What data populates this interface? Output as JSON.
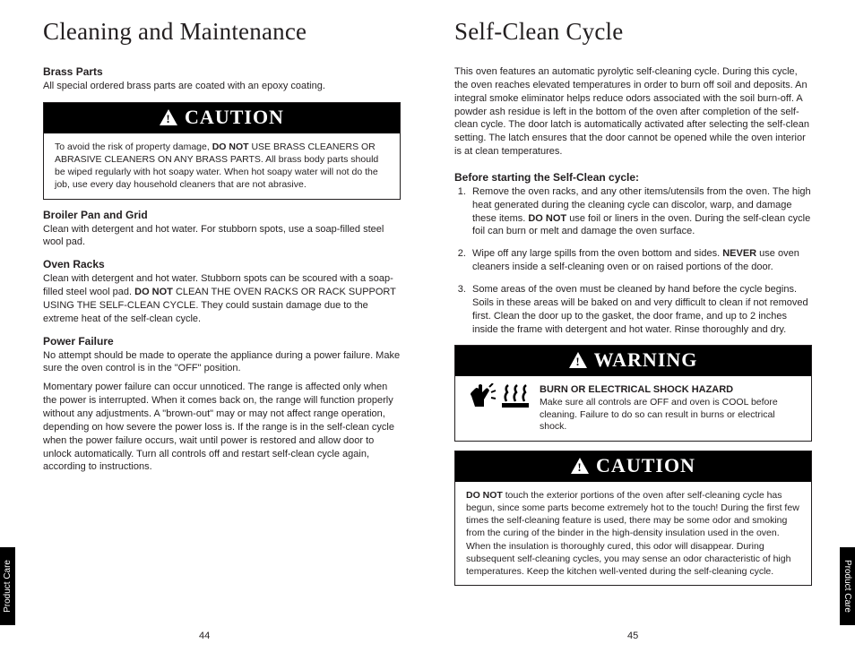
{
  "left": {
    "title": "Cleaning and Maintenance",
    "brass_h": "Brass Parts",
    "brass_p": "All special ordered brass parts are coated with an epoxy coating.",
    "caution_label": "CAUTION",
    "caution_body_pre": "To avoid the risk of property damage, ",
    "caution_body_bold": "DO NOT",
    "caution_body_post": " USE BRASS CLEANERS OR ABRASIVE CLEANERS ON ANY BRASS PARTS. All brass body parts should be wiped regularly with hot soapy water. When hot soapy water will not do the job, use every day household cleaners that are not abrasive.",
    "broiler_h": "Broiler Pan and Grid",
    "broiler_p": "Clean with detergent and hot water. For stubborn spots, use a soap-filled steel wool pad.",
    "racks_h": "Oven Racks",
    "racks_p_pre": "Clean with detergent and hot water. Stubborn spots can be scoured with a soap-filled steel wool pad. ",
    "racks_p_bold": "DO NOT",
    "racks_p_post": " CLEAN THE OVEN RACKS OR RACK SUPPORT USING THE SELF-CLEAN CYCLE. They could sustain damage due to the extreme heat of the self-clean cycle.",
    "power_h": "Power Failure",
    "power_p1": "No attempt should be made to operate the appliance during a power failure. Make sure the oven control is in the \"OFF\" position.",
    "power_p2": "Momentary power failure can occur unnoticed. The range is affected only when the power is interrupted. When it comes back on, the range will function properly without any adjustments. A \"brown-out\" may or may not affect range operation, depending on how severe the power loss is. If the range is in the self-clean cycle when the power failure occurs, wait until power is restored and allow door to unlock automatically. Turn all controls off and restart self-clean cycle again, according to instructions.",
    "page_num": "44",
    "tab": "Product Care"
  },
  "right": {
    "title": "Self-Clean Cycle",
    "intro": "This oven features an automatic pyrolytic self-cleaning cycle. During this cycle, the oven reaches elevated temperatures in order to burn off soil and deposits. An integral smoke eliminator helps reduce odors associated with the soil burn-off. A powder ash residue is left in the bottom of the oven after completion of the self-clean cycle. The door latch is automatically activated after selecting the self-clean setting. The latch ensures that the door cannot be opened while the oven interior is at clean temperatures.",
    "before_h": "Before starting the Self-Clean cycle:",
    "step1_pre": "Remove the oven racks, and any other items/utensils from the oven. The high heat generated during the cleaning cycle can discolor, warp, and damage these items. ",
    "step1_bold": "DO NOT",
    "step1_post": " use foil or liners in the oven. During the self-clean cycle foil can burn or melt and damage the oven surface.",
    "step2_pre": "Wipe off any large spills from the oven bottom and sides. ",
    "step2_bold": "NEVER",
    "step2_post": " use oven cleaners inside a self-cleaning oven or on raised portions of the door.",
    "step3": "Some areas of the oven must be cleaned by hand before the cycle begins. Soils in these areas will be baked on and very difficult to clean if not removed first. Clean the door up to the gasket, the door frame, and up to 2 inches inside the frame with detergent and hot water. Rinse thoroughly and dry.",
    "warning_label": "WARNING",
    "warn_h": "BURN OR ELECTRICAL SHOCK HAZARD",
    "warn_body": "Make sure all controls are OFF and oven is COOL before cleaning. Failure to do so can result in burns or electrical shock.",
    "caution_label": "CAUTION",
    "caution_bold": "DO NOT",
    "caution_body": " touch the exterior portions of the oven after self-cleaning cycle has begun, since some parts become extremely hot to the touch! During the first few times the self-cleaning feature is used, there may be some odor and smoking from the curing of the binder in the high-density insulation used in the oven. When the insulation is thoroughly cured, this odor will disappear. During subsequent self-cleaning cycles, you may sense an odor characteristic of high temperatures. Keep the kitchen well-vented during the self-cleaning cycle.",
    "page_num": "45",
    "tab": "Product Care"
  }
}
